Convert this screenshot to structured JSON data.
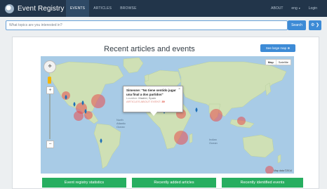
{
  "app": {
    "name": "Event Registry"
  },
  "nav": {
    "tabs": [
      {
        "label": "EVENTS",
        "active": true
      },
      {
        "label": "ARTICLES",
        "active": false
      },
      {
        "label": "BROWSE",
        "active": false
      }
    ],
    "right": {
      "about": "ABOUT",
      "language": "eng",
      "login": "Login"
    }
  },
  "search": {
    "placeholder": "What topics are you interested in?",
    "button_label": "Search",
    "options_label": "⚙ ❯"
  },
  "main": {
    "title": "Recent articles and events",
    "large_map_label": "See large map ⊕"
  },
  "map": {
    "type_buttons": [
      "Map",
      "Satellite"
    ],
    "footer": "Map data ©2014",
    "info": {
      "title": "Simeone: \"No tiene sentido jugar una final a dos partidos\"",
      "location_label": "Location:",
      "location_value": "Madrid, Spain",
      "count_label": "ARTICLES ABOUT EVENT:",
      "count_value": "39"
    },
    "colors": {
      "bubble": "#e74c4c",
      "ocean": "#a8cbe6",
      "land": "#cfe0b5"
    }
  },
  "bottom_tabs": [
    {
      "label": "Event registry statistics"
    },
    {
      "label": "Recently added articles"
    },
    {
      "label": "Recently identified events"
    }
  ],
  "colors": {
    "navbar": "#22354a",
    "accent": "#3d8bd6",
    "tab_green": "#27ae60"
  }
}
